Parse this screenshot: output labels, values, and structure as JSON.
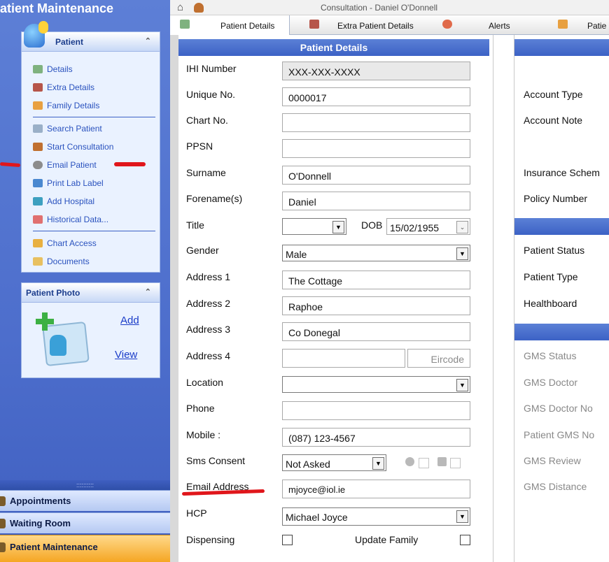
{
  "sidebar": {
    "title": "atient Maintenance",
    "patient_panel": {
      "header": "Patient",
      "items": [
        {
          "label": "Details",
          "icon": "details-icon"
        },
        {
          "label": "Extra Details",
          "icon": "extra-details-icon"
        },
        {
          "label": "Family Details",
          "icon": "family-icon"
        },
        {
          "label": "Search Patient",
          "icon": "search-icon"
        },
        {
          "label": "Start Consultation",
          "icon": "consultation-icon"
        },
        {
          "label": "Email Patient",
          "icon": "email-icon"
        },
        {
          "label": "Print Lab Label",
          "icon": "print-icon"
        },
        {
          "label": "Add Hospital",
          "icon": "hospital-icon"
        },
        {
          "label": "Historical Data...",
          "icon": "historical-icon"
        },
        {
          "label": "Chart Access",
          "icon": "chart-access-icon"
        },
        {
          "label": "Documents",
          "icon": "documents-icon"
        }
      ]
    },
    "photo_panel": {
      "header": "Patient Photo",
      "add": "Add",
      "view": "View"
    },
    "bottom": {
      "grip": "::::::::::",
      "appointments": "Appointments",
      "waiting_room": "Waiting Room",
      "patient_maintenance": "Patient Maintenance"
    }
  },
  "topbar": {
    "title": "Consultation - Daniel O'Donnell"
  },
  "tabs": [
    {
      "label": "Patient Details"
    },
    {
      "label": "Extra Patient Details"
    },
    {
      "label": "Alerts"
    },
    {
      "label": "Patie"
    }
  ],
  "form": {
    "header": "Patient Details",
    "ihi_label": "IHI Number",
    "ihi_value": "XXX-XXX-XXXX",
    "unique_label": "Unique No.",
    "unique_value": "0000017",
    "chart_label": "Chart No.",
    "chart_value": "",
    "ppsn_label": "PPSN",
    "ppsn_value": "",
    "surname_label": "Surname",
    "surname_value": "O'Donnell",
    "forename_label": "Forename(s)",
    "forename_value": "Daniel",
    "title_label": "Title",
    "title_value": "",
    "dob_label": "DOB",
    "dob_value": "15/02/1955",
    "gender_label": "Gender",
    "gender_value": "Male",
    "address1_label": "Address 1",
    "address1_value": "The Cottage",
    "address2_label": "Address 2",
    "address2_value": "Raphoe",
    "address3_label": "Address 3",
    "address3_value": "Co Donegal",
    "address4_label": "Address 4",
    "address4_value": "",
    "eircode_placeholder": "Eircode",
    "location_label": "Location",
    "location_value": "",
    "phone_label": "Phone",
    "phone_value": "",
    "mobile_label": "Mobile :",
    "mobile_value": "(087) 123-4567",
    "sms_label": "Sms Consent",
    "sms_value": "Not Asked",
    "email_label": "Email Address",
    "email_value": "mjoyce@iol.ie",
    "hcp_label": "HCP",
    "hcp_value": "Michael Joyce",
    "dispensing_label": "Dispensing",
    "update_family_label": "Update Family"
  },
  "right": {
    "account_type": "Account Type",
    "account_note": "Account Note",
    "insurance_scheme": "Insurance Schem",
    "policy_number": "Policy Number",
    "patient_status": "Patient Status",
    "patient_type": "Patient Type",
    "healthboard": "Healthboard",
    "gms_status": "GMS Status",
    "gms_doctor": "GMS Doctor",
    "gms_doctor_no": "GMS Doctor No",
    "patient_gms_no": "Patient GMS No",
    "gms_review": "GMS Review",
    "gms_distance": "GMS Distance"
  },
  "colors": {
    "sidebar_blue": "#4d6ecc",
    "header_blue": "#3c62c5",
    "link_blue": "#2a52be",
    "active_orange": "#f5a623",
    "annotation_red": "#e0161b"
  }
}
